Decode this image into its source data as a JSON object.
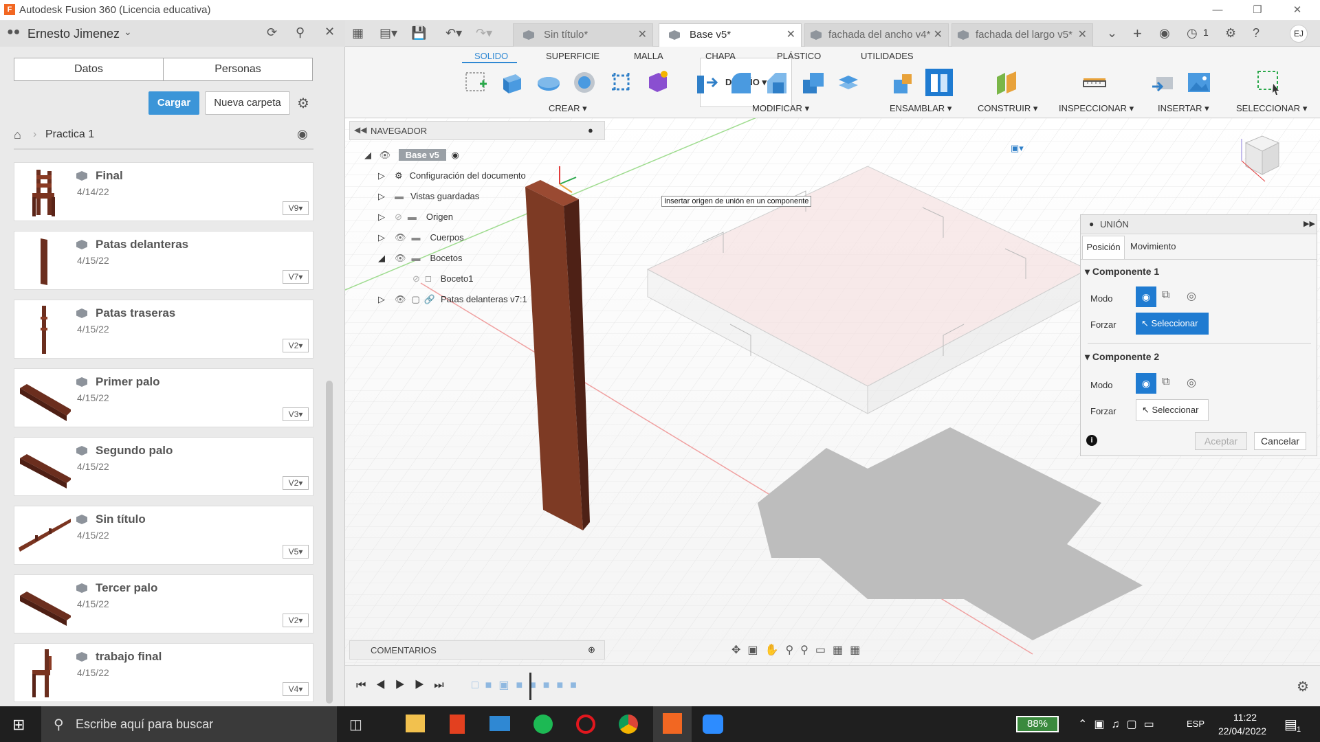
{
  "window": {
    "title": "Autodesk Fusion 360 (Licencia educativa)"
  },
  "left_panel": {
    "user": "Ernesto Jimenez",
    "tabs": [
      "Datos",
      "Personas"
    ],
    "upload_label": "Cargar",
    "new_folder_label": "Nueva carpeta",
    "breadcrumb": "Practica 1",
    "files": [
      {
        "name": "Final",
        "date": "4/14/22",
        "version": "V9"
      },
      {
        "name": "Patas delanteras",
        "date": "4/15/22",
        "version": "V7"
      },
      {
        "name": "Patas traseras",
        "date": "4/15/22",
        "version": "V2"
      },
      {
        "name": "Primer palo",
        "date": "4/15/22",
        "version": "V3"
      },
      {
        "name": "Segundo palo",
        "date": "4/15/22",
        "version": "V2"
      },
      {
        "name": "Sin título",
        "date": "4/15/22",
        "version": "V5"
      },
      {
        "name": "Tercer palo",
        "date": "4/15/22",
        "version": "V2"
      },
      {
        "name": "trabajo final",
        "date": "4/15/22",
        "version": "V4"
      }
    ]
  },
  "doc_tabs": [
    {
      "label": "Sin título*",
      "active": false
    },
    {
      "label": "Base v5*",
      "active": true
    },
    {
      "label": "fachada del ancho v4*",
      "active": false
    },
    {
      "label": "fachada del largo v5*",
      "active": false
    }
  ],
  "notifications_count": "1",
  "user_initials": "EJ",
  "toolbar": {
    "workspace": "DISEÑO",
    "tabs": [
      "SOLIDO",
      "SUPERFICIE",
      "MALLA",
      "CHAPA",
      "PLÁSTICO",
      "UTILIDADES"
    ],
    "groups": [
      "CREAR",
      "MODIFICAR",
      "ENSAMBLAR",
      "CONSTRUIR",
      "INSPECCIONAR",
      "INSERTAR",
      "SELECCIONAR"
    ]
  },
  "navigator": {
    "title": "NAVEGADOR",
    "root": "Base v5",
    "items": [
      {
        "label": "Configuración del documento"
      },
      {
        "label": "Vistas guardadas"
      },
      {
        "label": "Origen"
      },
      {
        "label": "Cuerpos"
      },
      {
        "label": "Bocetos"
      },
      {
        "label": "Boceto1"
      },
      {
        "label": "Patas delanteras v7:1"
      }
    ]
  },
  "tooltip": "Insertar origen de unión en un componente",
  "union_panel": {
    "title": "UNIÓN",
    "tabs": [
      "Posición",
      "Movimiento"
    ],
    "component1": {
      "title": "Componente 1",
      "mode_label": "Modo",
      "force_label": "Forzar",
      "select_label": "Seleccionar"
    },
    "component2": {
      "title": "Componente 2",
      "mode_label": "Modo",
      "force_label": "Forzar",
      "select_label": "Seleccionar"
    },
    "ok_label": "Aceptar",
    "cancel_label": "Cancelar"
  },
  "comments": {
    "title": "COMENTARIOS"
  },
  "taskbar": {
    "search_placeholder": "Escribe aquí para buscar",
    "battery": "88%",
    "language": "ESP",
    "time": "11:22",
    "date": "22/04/2022",
    "notification_count": "1"
  }
}
